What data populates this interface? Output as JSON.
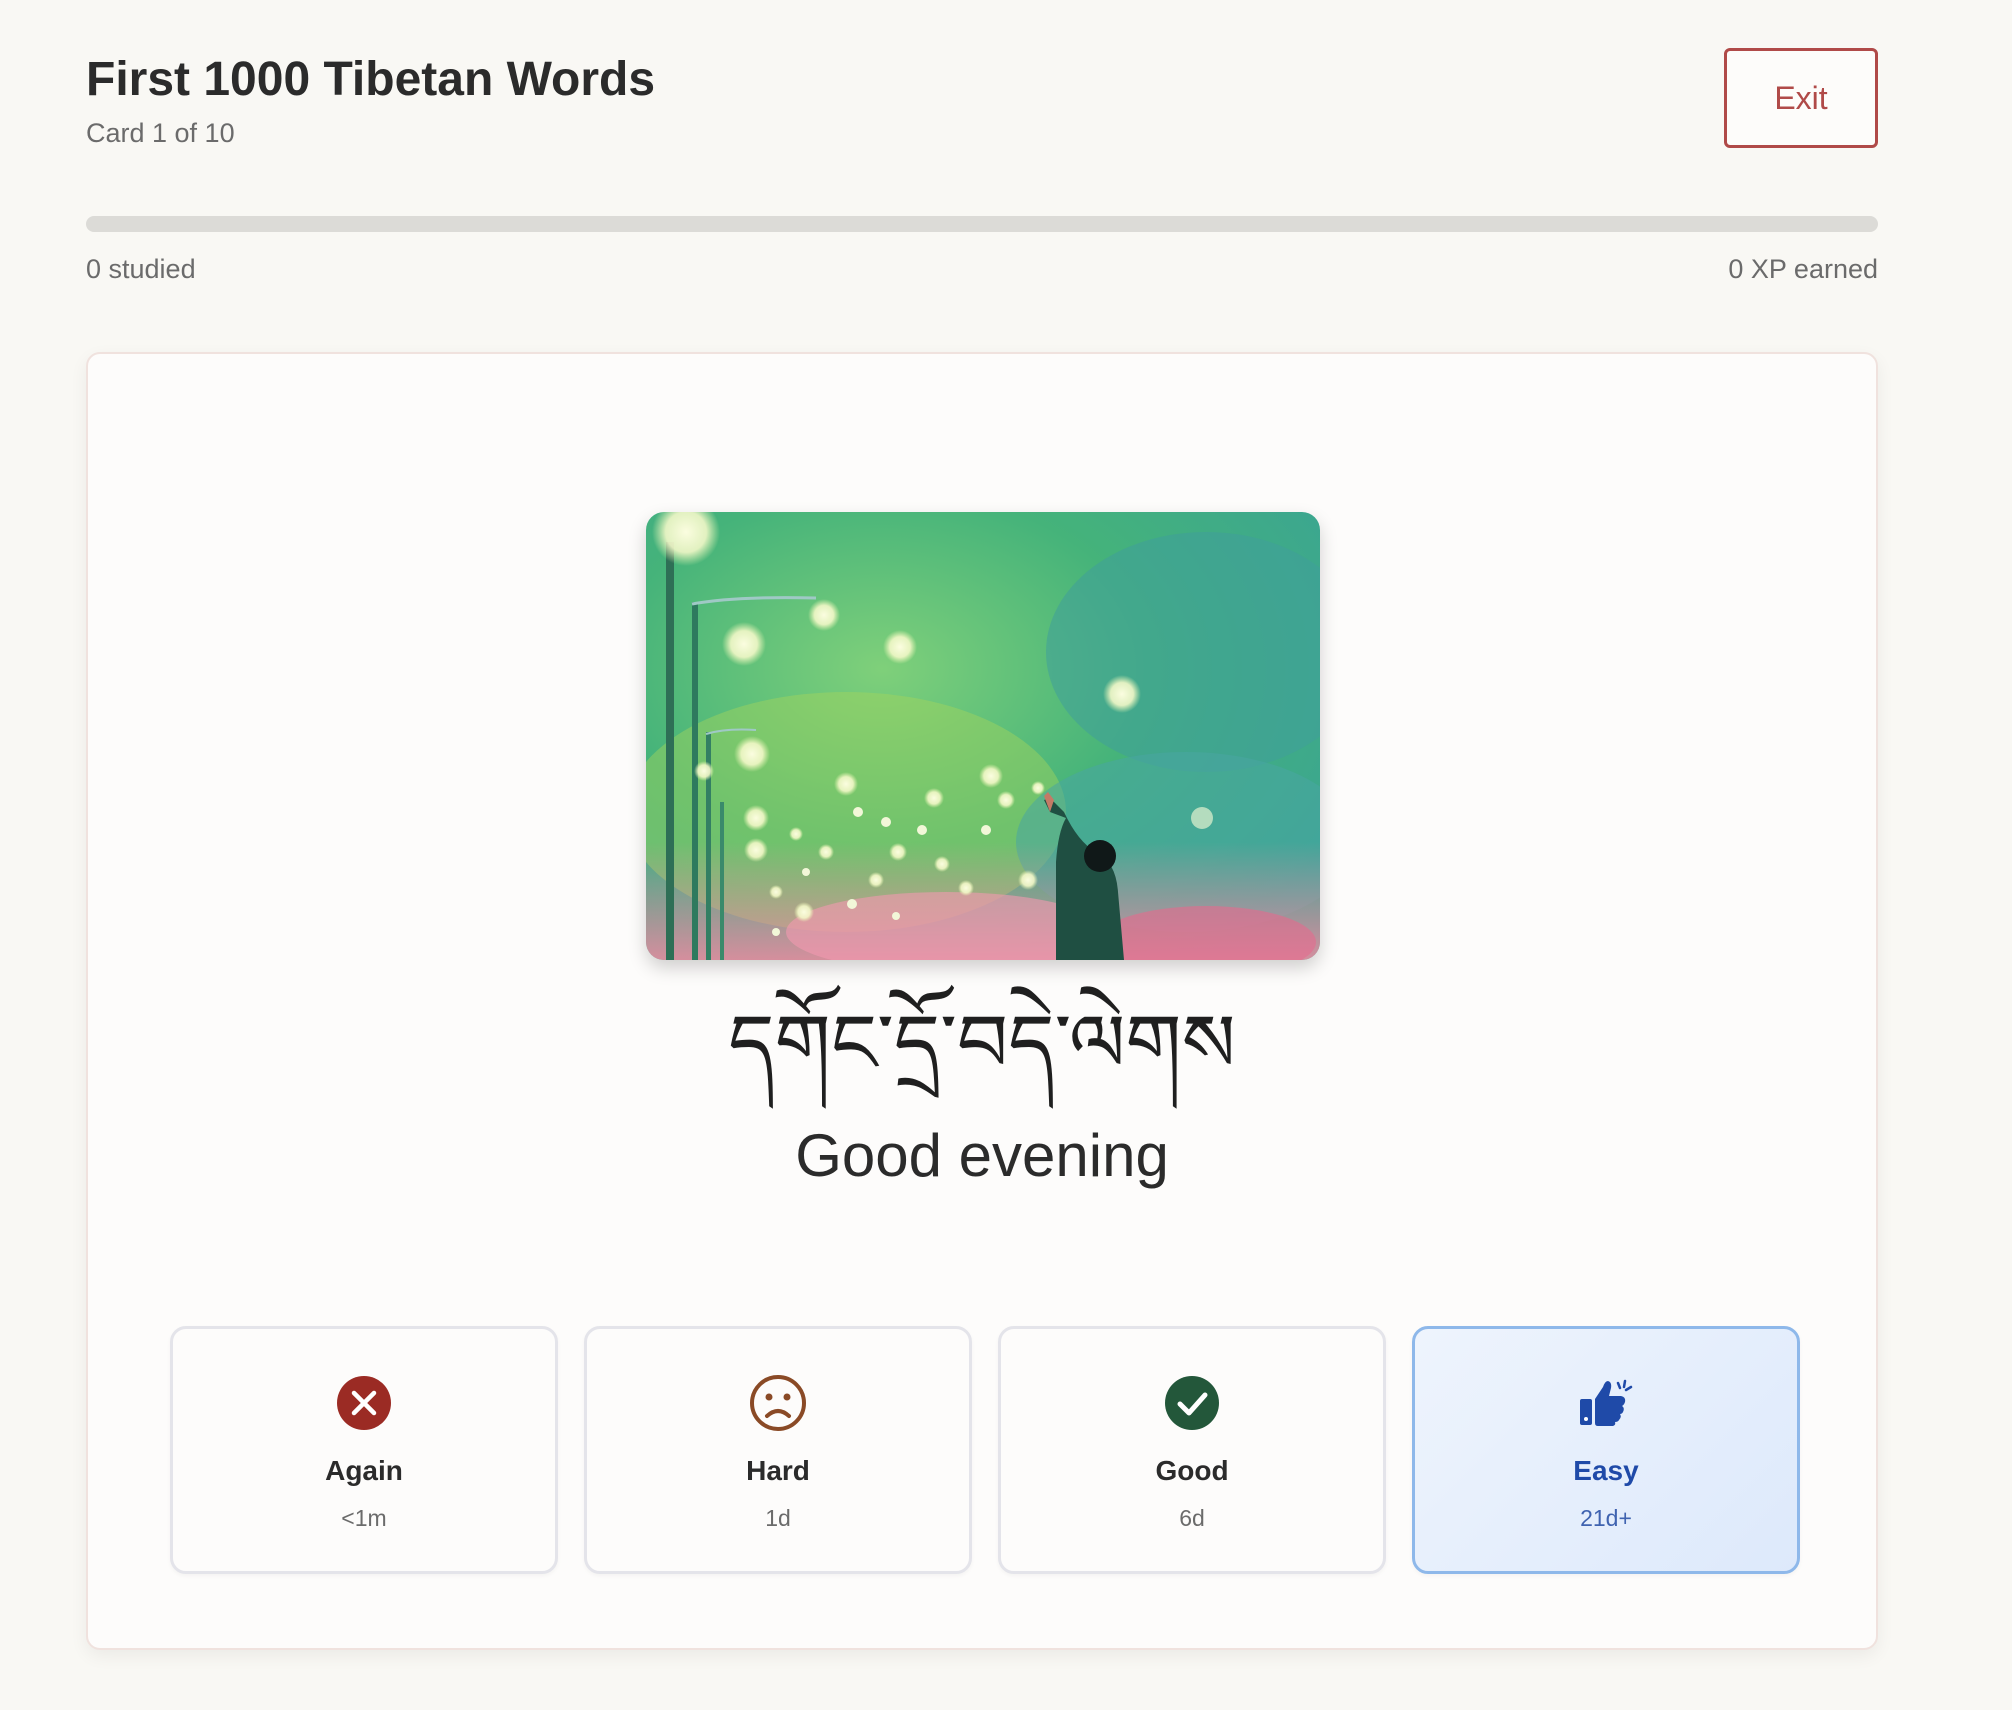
{
  "header": {
    "title": "First 1000 Tibetan Words",
    "card_counter": "Card 1 of 10",
    "exit_label": "Exit"
  },
  "progress": {
    "fraction": 0,
    "studied_text": "0 studied",
    "xp_text": "0 XP earned"
  },
  "card": {
    "illustration_icon": "evening-lights-illustration",
    "tibetan_text": "དགོང་དྲོ་བདེ་ལེགས",
    "english_text": "Good evening"
  },
  "ratings": [
    {
      "label": "Again",
      "interval": "<1m",
      "icon": "x-circle-icon",
      "color": "#9b2b24"
    },
    {
      "label": "Hard",
      "interval": "1d",
      "icon": "frown-icon",
      "color": "#8a4a26"
    },
    {
      "label": "Good",
      "interval": "6d",
      "icon": "check-circle-icon",
      "color": "#23573a"
    },
    {
      "label": "Easy",
      "interval": "21d+",
      "icon": "thumbs-up-icon",
      "color": "#1f4aa8"
    }
  ],
  "colors": {
    "accent": "#b04a48",
    "background": "#f9f8f4",
    "easy_border": "#8eb8ea"
  }
}
